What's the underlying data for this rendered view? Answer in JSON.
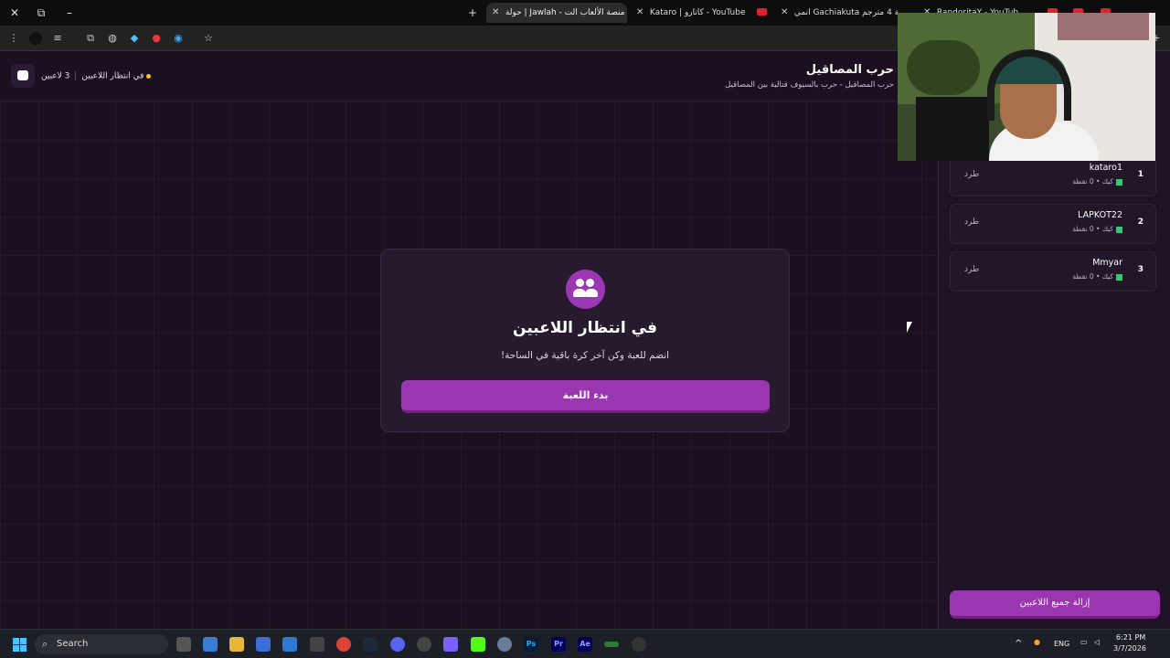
{
  "browser": {
    "tabs": [
      {
        "title": "حولة | Jawlah - منصة الألعاب الت",
        "active": true
      },
      {
        "title": "Kataro | كاتارو - YouTube",
        "active": false
      },
      {
        "title": "انمي Gachiakuta الحلقة 4 مترجم",
        "active": false
      },
      {
        "title": "RandoritaY - YouTube",
        "active": false
      }
    ]
  },
  "header": {
    "status_state": "في انتظار اللاعبين",
    "player_count": "3 لاعبين",
    "game_title": "حرب المصاقيل",
    "game_subtitle": "حرب المصاقيل - حرب بالسيوف قتالية بين المصاقيل"
  },
  "card": {
    "title": "في انتظار اللاعبين",
    "description": "انضم للعبة وكن آخر كرة باقية في الساحة!",
    "start_button": "بدء اللعبة"
  },
  "players": [
    {
      "rank": "1",
      "name": "kataro1",
      "platform": "كيك",
      "points": "0 نقطة",
      "kick_label": "طرد"
    },
    {
      "rank": "2",
      "name": "LAPKOT22",
      "platform": "كيك",
      "points": "0 نقطة",
      "kick_label": "طرد"
    },
    {
      "rank": "3",
      "name": "Mmyar",
      "platform": "كيك",
      "points": "0 نقطة",
      "kick_label": "طرد"
    }
  ],
  "sidebar": {
    "remove_all_button": "إزالة جميع اللاعبين"
  },
  "taskbar": {
    "search_label": "Search",
    "language": "ENG",
    "time": "6:21 PM",
    "date": "3/7/2026"
  },
  "colors": {
    "accent": "#9a36b0",
    "status_dot": "#f5c518",
    "kick_green": "#2ecc71"
  }
}
